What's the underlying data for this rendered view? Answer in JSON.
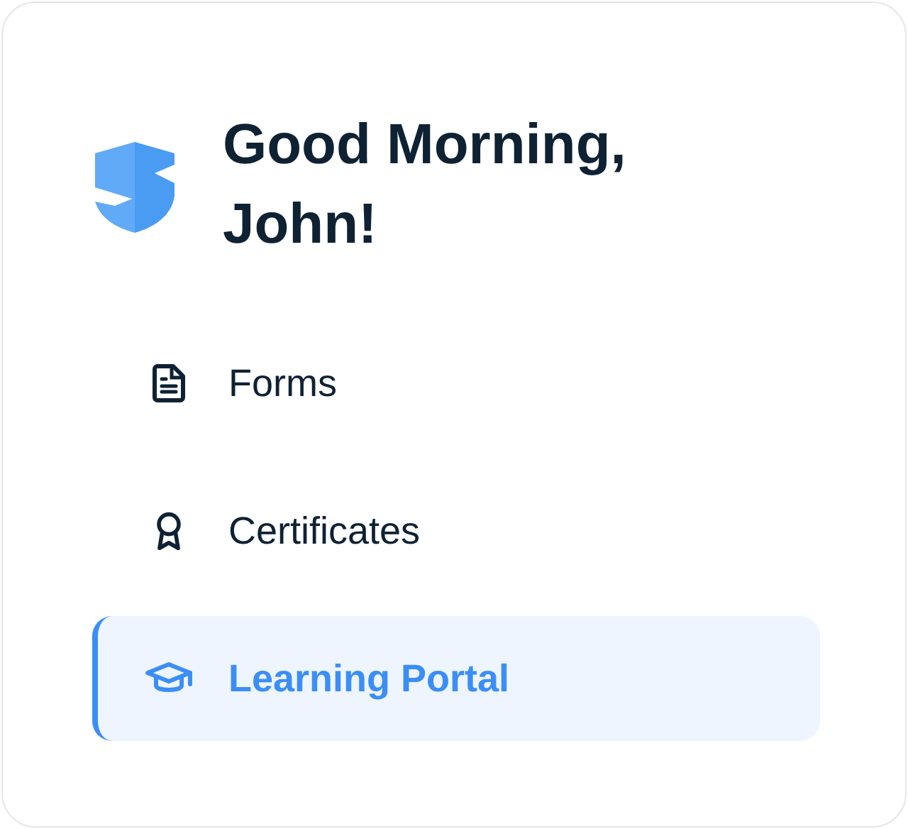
{
  "greeting": "Good Morning, John!",
  "nav_items": [
    {
      "label": "Forms",
      "selected": false
    },
    {
      "label": "Certificates",
      "selected": false
    },
    {
      "label": "Learning Portal",
      "selected": true
    }
  ]
}
